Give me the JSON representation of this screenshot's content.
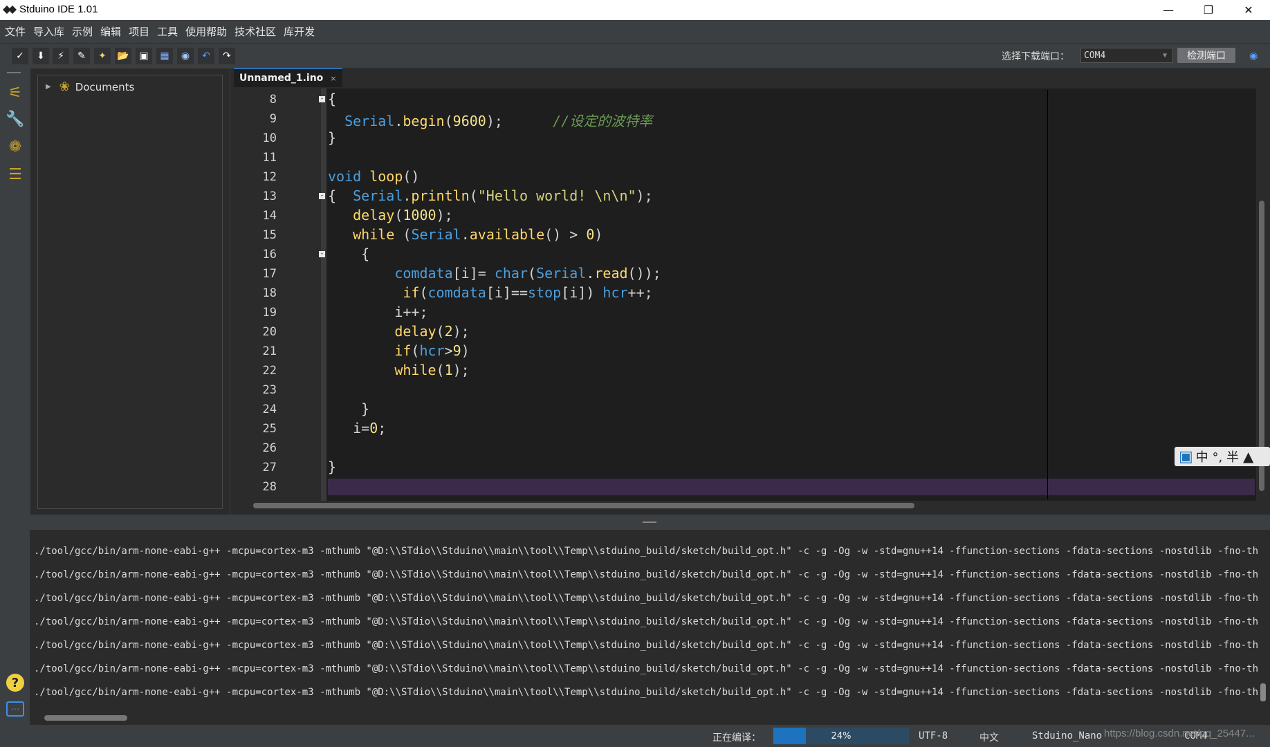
{
  "window": {
    "title": "Stduino IDE 1.01"
  },
  "menu": [
    "文件",
    "导入库",
    "示例",
    "编辑",
    "项目",
    "工具",
    "使用帮助",
    "技术社区",
    "库开发"
  ],
  "toolbar": {
    "port_label": "选择下载端口：",
    "port_value": "COM4",
    "detect_button": "检测端口",
    "buttons": [
      "verify-icon",
      "download-icon",
      "flash-icon",
      "erase-icon",
      "new-file-icon",
      "open-folder-icon",
      "save-icon",
      "save-all-icon",
      "find-icon",
      "undo-icon",
      "redo-icon"
    ]
  },
  "sidebar": {
    "tree_root": "Documents"
  },
  "editor": {
    "tab_label": "Unnamed_1.ino",
    "tab_close": "×",
    "line_numbers": [
      "8",
      "9",
      "10",
      "11",
      "12",
      "13",
      "14",
      "15",
      "16",
      "17",
      "18",
      "19",
      "20",
      "21",
      "22",
      "23",
      "24",
      "25",
      "26",
      "27",
      "28"
    ]
  },
  "ime": {
    "label": "中 °, 半"
  },
  "console": {
    "lines": [
      "./tool/gcc/bin/arm-none-eabi-g++ -mcpu=cortex-m3 -mthumb \"@D:\\\\STdio\\\\Stduino\\\\main\\\\tool\\\\Temp\\\\stduino_build/sketch/build_opt.h\" -c -g -Og -w -std=gnu++14 -ffunction-sections -fdata-sections -nostdlib -fno-threadsafe-st",
      "./tool/gcc/bin/arm-none-eabi-g++ -mcpu=cortex-m3 -mthumb \"@D:\\\\STdio\\\\Stduino\\\\main\\\\tool\\\\Temp\\\\stduino_build/sketch/build_opt.h\" -c -g -Og -w -std=gnu++14 -ffunction-sections -fdata-sections -nostdlib -fno-threadsafe-st",
      "./tool/gcc/bin/arm-none-eabi-g++ -mcpu=cortex-m3 -mthumb \"@D:\\\\STdio\\\\Stduino\\\\main\\\\tool\\\\Temp\\\\stduino_build/sketch/build_opt.h\" -c -g -Og -w -std=gnu++14 -ffunction-sections -fdata-sections -nostdlib -fno-threadsafe-st",
      "./tool/gcc/bin/arm-none-eabi-g++ -mcpu=cortex-m3 -mthumb \"@D:\\\\STdio\\\\Stduino\\\\main\\\\tool\\\\Temp\\\\stduino_build/sketch/build_opt.h\" -c -g -Og -w -std=gnu++14 -ffunction-sections -fdata-sections -nostdlib -fno-threadsafe-st",
      "./tool/gcc/bin/arm-none-eabi-g++ -mcpu=cortex-m3 -mthumb \"@D:\\\\STdio\\\\Stduino\\\\main\\\\tool\\\\Temp\\\\stduino_build/sketch/build_opt.h\" -c -g -Og -w -std=gnu++14 -ffunction-sections -fdata-sections -nostdlib -fno-threadsafe-st",
      "./tool/gcc/bin/arm-none-eabi-g++ -mcpu=cortex-m3 -mthumb \"@D:\\\\STdio\\\\Stduino\\\\main\\\\tool\\\\Temp\\\\stduino_build/sketch/build_opt.h\" -c -g -Og -w -std=gnu++14 -ffunction-sections -fdata-sections -nostdlib -fno-threadsafe-st",
      "./tool/gcc/bin/arm-none-eabi-g++ -mcpu=cortex-m3 -mthumb \"@D:\\\\STdio\\\\Stduino\\\\main\\\\tool\\\\Temp\\\\stduino_build/sketch/build_opt.h\" -c -g -Og -w -std=gnu++14 -ffunction-sections -fdata-sections -nostdlib -fno-threadsafe-st"
    ]
  },
  "status": {
    "compiling_label": "正在编译：",
    "progress_text": "24%",
    "progress_fraction": 0.24,
    "encoding": "UTF-8",
    "language": "中文",
    "board": "Stduino_Nano",
    "port_info": "COM4",
    "watermark": "https://blog.csdn.net/qq_25447..."
  },
  "colors": {
    "keyword": "#4aa0e0",
    "function": "#ffd76b",
    "comment": "#6a9955",
    "accent": "#1e73be"
  }
}
